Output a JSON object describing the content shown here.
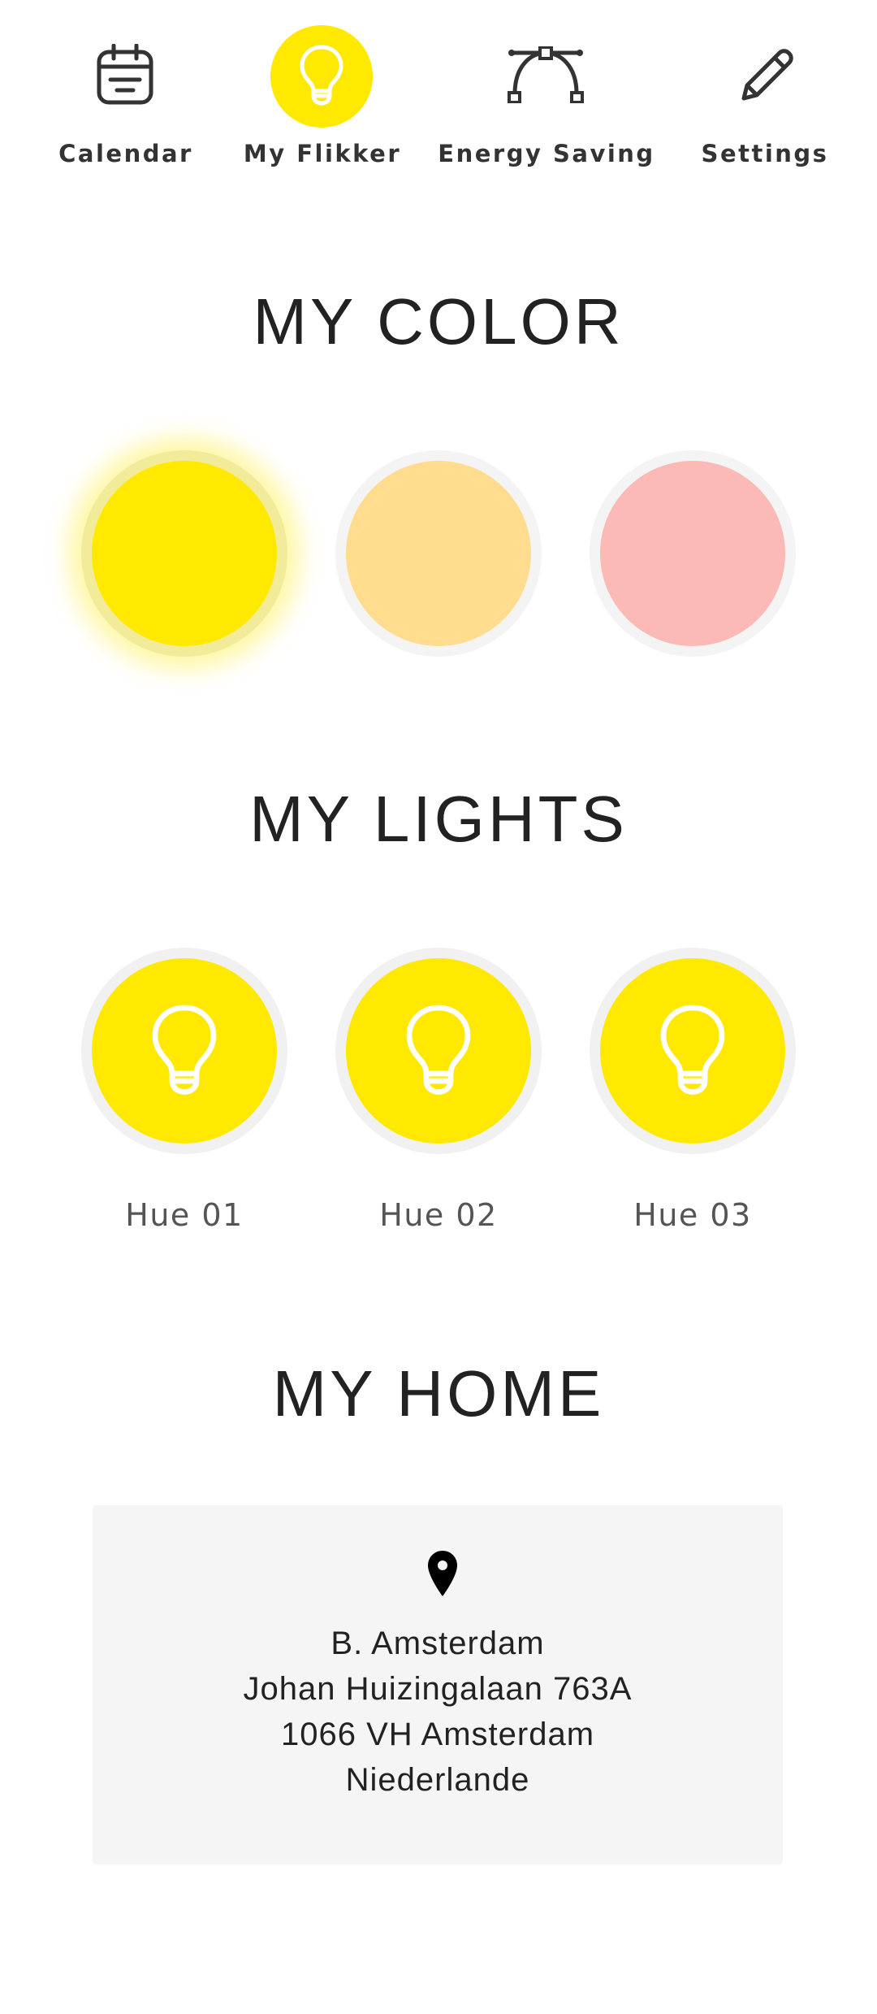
{
  "nav": {
    "items": [
      {
        "label": "Calendar",
        "icon": "calendar-icon",
        "active": false
      },
      {
        "label": "My Flikker",
        "icon": "bulb-icon",
        "active": true
      },
      {
        "label": "Energy Saving",
        "icon": "bezier-curve-icon",
        "active": false
      },
      {
        "label": "Settings",
        "icon": "pencil-icon",
        "active": false
      }
    ]
  },
  "sections": {
    "color_title": "MY COLOR",
    "lights_title": "MY LIGHTS",
    "home_title": "MY HOME"
  },
  "colors": [
    {
      "name": "yellow",
      "hex": "#ffe900",
      "selected": true
    },
    {
      "name": "peach",
      "hex": "#ffdc8e",
      "selected": false
    },
    {
      "name": "pink",
      "hex": "#fbbab5",
      "selected": false
    }
  ],
  "lights": [
    {
      "label": "Hue 01",
      "icon": "bulb-icon"
    },
    {
      "label": "Hue 02",
      "icon": "bulb-icon"
    },
    {
      "label": "Hue 03",
      "icon": "bulb-icon"
    }
  ],
  "home": {
    "icon": "map-pin-icon",
    "address_lines": [
      "B. Amsterdam",
      "Johan Huizingalaan 763A",
      "1066 VH Amsterdam",
      "Niederlande"
    ]
  },
  "theme": {
    "accent": "#ffe900",
    "text": "#222222",
    "card_bg": "#f5f5f5"
  }
}
